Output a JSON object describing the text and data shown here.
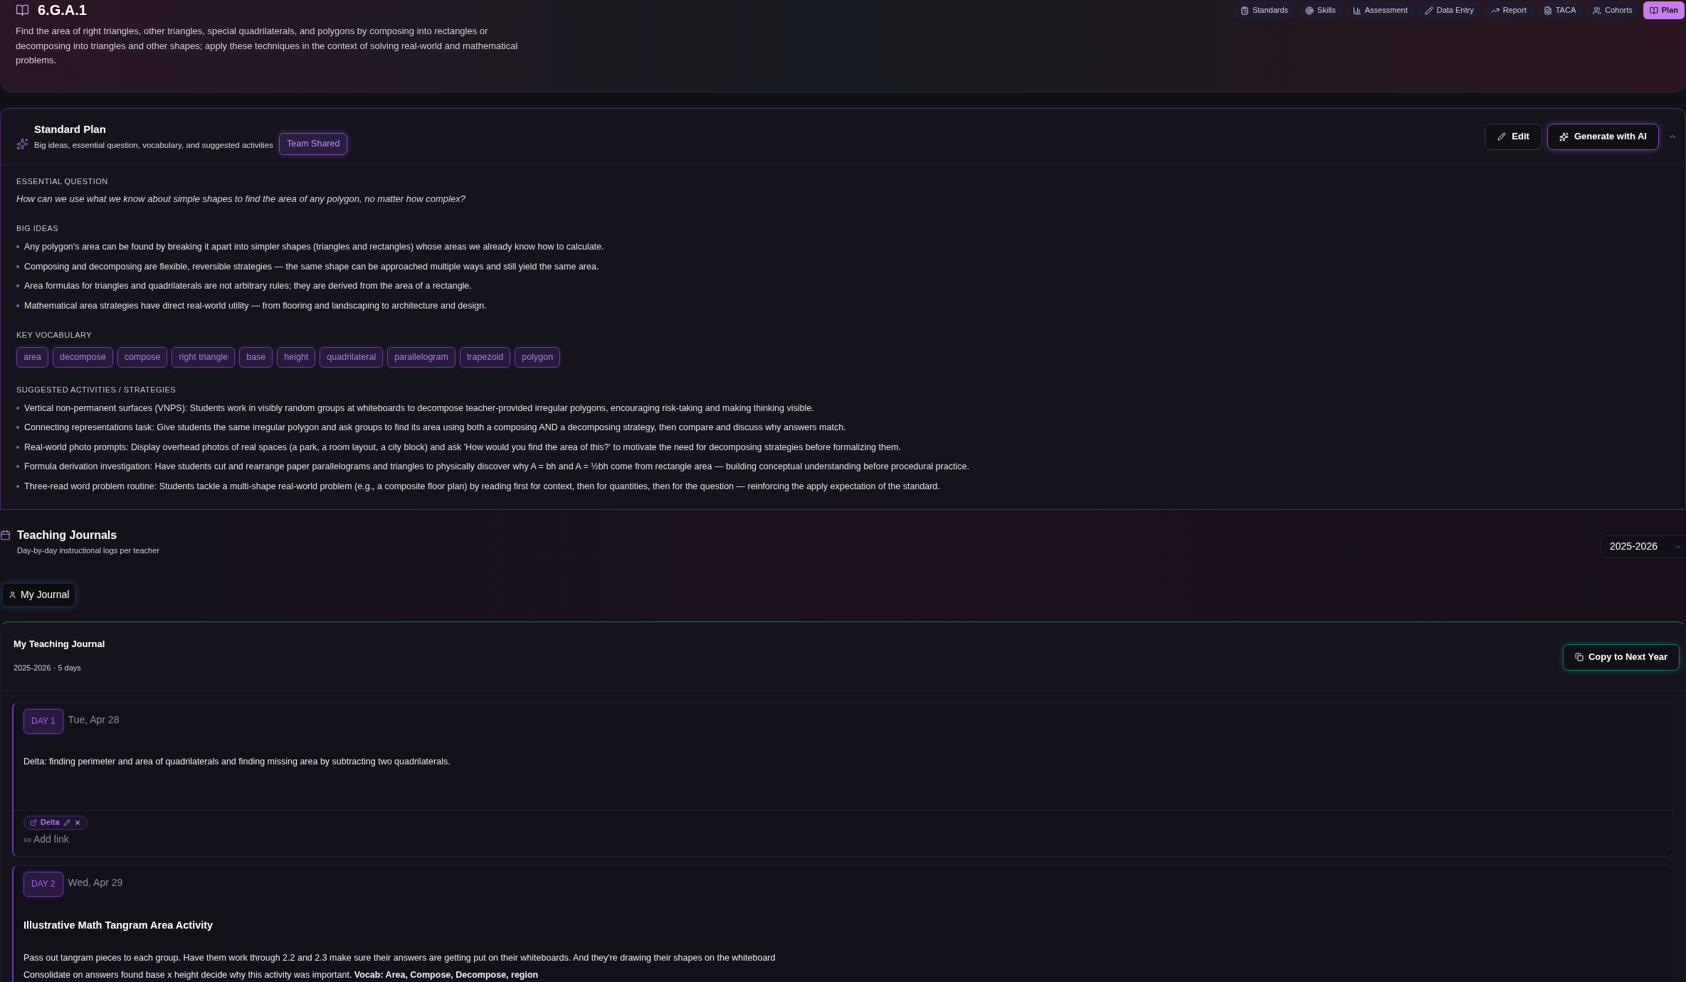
{
  "standard": {
    "code": "6.G.A.1",
    "description": "Find the area of right triangles, other triangles, special quadrilaterals, and polygons by composing into rectangles or decomposing into triangles and other shapes; apply these techniques in the context of solving real-world and mathematical problems."
  },
  "nav_tabs": [
    {
      "label": "Standards",
      "selected": false
    },
    {
      "label": "Skills",
      "selected": false
    },
    {
      "label": "Assessment",
      "selected": false
    },
    {
      "label": "Data Entry",
      "selected": false
    },
    {
      "label": "Report",
      "selected": false
    },
    {
      "label": "TACA",
      "selected": false
    },
    {
      "label": "Cohorts",
      "selected": false
    },
    {
      "label": "Plan",
      "selected": true
    }
  ],
  "standard_plan": {
    "title": "Standard Plan",
    "subtitle": "Big ideas, essential question, vocabulary, and suggested activities",
    "badge": "Team Shared",
    "edit_button": "Edit",
    "generate_button": "Generate with AI",
    "expanded": true,
    "sections": [
      {
        "kind": "question",
        "heading": "ESSENTIAL QUESTION",
        "text": "How can we use what we know about simple shapes to find the area of any polygon, no matter how complex?"
      },
      {
        "kind": "list",
        "heading": "BIG IDEAS",
        "items": [
          "Any polygon's area can be found by breaking it apart into simpler shapes (triangles and rectangles) whose areas we already know how to calculate.",
          "Composing and decomposing are flexible, reversible strategies — the same shape can be approached multiple ways and still yield the same area.",
          "Area formulas for triangles and quadrilaterals are not arbitrary rules; they are derived from the area of a rectangle.",
          "Mathematical area strategies have direct real-world utility — from flooring and landscaping to architecture and design."
        ]
      },
      {
        "kind": "chips",
        "heading": "KEY VOCABULARY",
        "items": [
          "area",
          "decompose",
          "compose",
          "right triangle",
          "base",
          "height",
          "quadrilateral",
          "parallelogram",
          "trapezoid",
          "polygon"
        ]
      },
      {
        "kind": "list",
        "heading": "SUGGESTED ACTIVITIES / STRATEGIES",
        "items": [
          "Vertical non-permanent surfaces (VNPS): Students work in visibly random groups at whiteboards to decompose teacher-provided irregular polygons, encouraging risk-taking and making thinking visible.",
          "Connecting representations task: Give students the same irregular polygon and ask groups to find its area using both a composing AND a decomposing strategy, then compare and discuss why answers match.",
          "Real-world photo prompts: Display overhead photos of real spaces (a park, a room layout, a city block) and ask 'How would you find the area of this?' to motivate the need for decomposing strategies before formalizing them.",
          "Formula derivation investigation: Have students cut and rearrange paper parallelograms and triangles to physically discover why A = bh and A = ½bh come from rectangle area — building conceptual understanding before procedural practice.",
          "Three-read word problem routine: Students tackle a multi-shape real-world problem (e.g., a composite floor plan) by reading first for context, then for quantities, then for the question — reinforcing the apply expectation of the standard."
        ]
      }
    ]
  },
  "teaching_journals": {
    "title": "Teaching Journals",
    "subtitle": "Day-by-day instructional logs per teacher",
    "year_select": {
      "value": "2025-2026"
    },
    "journal_tabs": [
      {
        "label": "My Journal",
        "selected": true
      }
    ],
    "journal": {
      "title": "My Teaching Journal",
      "meta": "2025-2026 · 5 days",
      "copy_button": "Copy to Next Year",
      "days": [
        {
          "badge": "DAY 1",
          "date": "Tue, Apr 28",
          "paragraphs": [
            "Delta: finding perimeter and area of quadrilaterals and finding missing area by subtracting two quadrilaterals."
          ],
          "links": [
            {
              "label": "Delta"
            }
          ],
          "add_link": "Add link"
        },
        {
          "badge": "DAY 2",
          "date": "Wed, Apr 29",
          "title": "Illustrative Math Tangram Area Activity",
          "paragraphs": [
            "Pass out tangram pieces to each group. Have them work through 2.2 and 2.3 make sure their answers are getting put on their whiteboards. And they're drawing their shapes on the whiteboard",
            "Consolidate on answers found base x height decide why this activity was important. **Vocab: Area, Compose, Decompose, region**"
          ]
        }
      ]
    }
  }
}
